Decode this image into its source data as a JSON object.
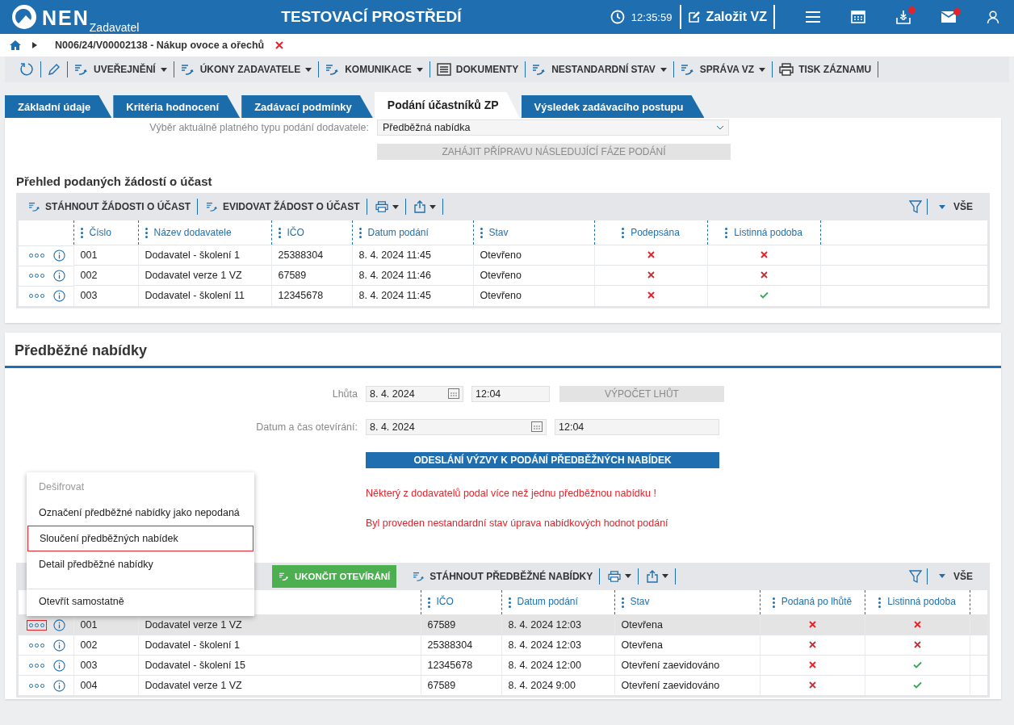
{
  "header": {
    "logo": "NEN",
    "role": "Zadavatel",
    "title": "TESTOVACÍ PROSTŘEDÍ",
    "time": "12:35:59",
    "create_button": "Založit VZ",
    "inbox_alert": true,
    "mail_alert": true
  },
  "breadcrumb": {
    "path": "N006/24/V00002138 - Nákup ovoce a ořechů"
  },
  "toolbar": [
    {
      "kind": "refresh"
    },
    {
      "kind": "edit"
    },
    {
      "kind": "flow",
      "label": "UVEŘEJNĚNÍ",
      "dropdown": true
    },
    {
      "kind": "flow",
      "label": "ÚKONY ZADAVATELE",
      "dropdown": true
    },
    {
      "kind": "flow",
      "label": "KOMUNIKACE",
      "dropdown": true
    },
    {
      "kind": "doc",
      "label": "DOKUMENTY",
      "dropdown": false
    },
    {
      "kind": "flow",
      "label": "NESTANDARDNÍ STAV",
      "dropdown": true
    },
    {
      "kind": "flow",
      "label": "SPRÁVA VZ",
      "dropdown": true
    },
    {
      "kind": "print",
      "label": "TISK ZÁZNAMU",
      "dropdown": false
    }
  ],
  "tabs": [
    {
      "label": "Základní údaje",
      "selected": false
    },
    {
      "label": "Kritéria hodnocení",
      "selected": false
    },
    {
      "label": "Zadávací podmínky",
      "selected": false
    },
    {
      "label": "Podání účastníků ZP",
      "selected": true
    },
    {
      "label": "Výsledek zadávacího postupu",
      "selected": false
    }
  ],
  "submission_type": {
    "label": "Výběr aktuálně platného typu podání dodavatele:",
    "value": "Předběžná nabídka"
  },
  "next_phase_button": {
    "label": "ZAHÁJIT PŘÍPRAVU NÁSLEDUJÍCÍ FÁZE PODÁNÍ",
    "disabled": true
  },
  "requests": {
    "title": "Přehled podaných žádostí o účast",
    "actions": [
      "STÁHNOUT ŽÁDOSTI O ÚČAST",
      "EVIDOVAT ŽÁDOST O ÚČAST"
    ],
    "filter_label": "VŠE",
    "columns": [
      "Číslo",
      "Název dodavatele",
      "IČO",
      "Datum podání",
      "Stav",
      "Podepsána",
      "Listinná podoba"
    ],
    "rows": [
      {
        "number": "001",
        "supplier": "Dodavatel - školení 1",
        "ico": "25388304",
        "date": "8. 4. 2024 11:45",
        "status": "Otevřeno",
        "signed": false,
        "paper": false
      },
      {
        "number": "002",
        "supplier": "Dodavatel verze 1 VZ",
        "ico": "67589",
        "date": "8. 4. 2024 11:46",
        "status": "Otevřeno",
        "signed": false,
        "paper": false
      },
      {
        "number": "003",
        "supplier": "Dodavatel - školení 11",
        "ico": "12345678",
        "date": "8. 4. 2024 11:45",
        "status": "Otevřeno",
        "signed": false,
        "paper": true
      }
    ]
  },
  "preliminary": {
    "title": "Předběžné nabídky",
    "deadline": {
      "label": "Lhůta",
      "date": "8. 4. 2024",
      "time": "12:04"
    },
    "calc_button": {
      "label": "VÝPOČET LHŮT",
      "disabled": true
    },
    "opening": {
      "label": "Datum a čas otevírání:",
      "date": "8. 4. 2024",
      "time": "12:04"
    },
    "send_button": "ODESLÁNÍ VÝZVY K PODÁNÍ PŘEDBĚŽNÝCH NABÍDEK",
    "warnings": [
      "Některý z dodavatelů podal více než jednu předběžnou nabídku !",
      "Byl proveden nestandardní stav úprava nabídkových hodnot podání"
    ],
    "end_button": "UKONČIT OTEVÍRÁNÍ",
    "download_button": "STÁHNOUT PŘEDBĚŽNÉ NABÍDKY",
    "filter_label": "VŠE",
    "columns": [
      "IČO",
      "Datum podání",
      "Stav",
      "Podaná po lhůtě",
      "Listinná podoba"
    ],
    "rows": [
      {
        "selected": true,
        "number": "001",
        "supplier": "Dodavatel verze 1 VZ",
        "ico": "67589",
        "date": "8. 4. 2024 12:03",
        "status": "Otevřena",
        "late": false,
        "paper": false
      },
      {
        "selected": false,
        "number": "002",
        "supplier": "Dodavatel - školení 1",
        "ico": "25388304",
        "date": "8. 4. 2024 12:03",
        "status": "Otevřena",
        "late": false,
        "paper": false
      },
      {
        "selected": false,
        "number": "003",
        "supplier": "Dodavatel - školení 15",
        "ico": "12345678",
        "date": "8. 4. 2024 12:00",
        "status": "Otevření zaevidováno",
        "late": false,
        "paper": true
      },
      {
        "selected": false,
        "number": "004",
        "supplier": "Dodavatel verze 1 VZ",
        "ico": "67589",
        "date": "8. 4. 2024 9:00",
        "status": "Otevření zaevidováno",
        "late": false,
        "paper": true
      }
    ]
  },
  "context_menu": {
    "items": [
      {
        "label": "Dešifrovat",
        "disabled": true,
        "highlighted": false,
        "separated": false
      },
      {
        "label": "Označení předběžné nabídky jako nepodaná",
        "disabled": false,
        "highlighted": false,
        "separated": false
      },
      {
        "label": "Sloučení předběžných nabídek",
        "disabled": false,
        "highlighted": true,
        "separated": false
      },
      {
        "label": "Detail předběžné nabídky",
        "disabled": false,
        "highlighted": false,
        "separated": false
      },
      {
        "label": "Otevřít samostatně",
        "disabled": false,
        "highlighted": false,
        "separated": true
      }
    ]
  }
}
